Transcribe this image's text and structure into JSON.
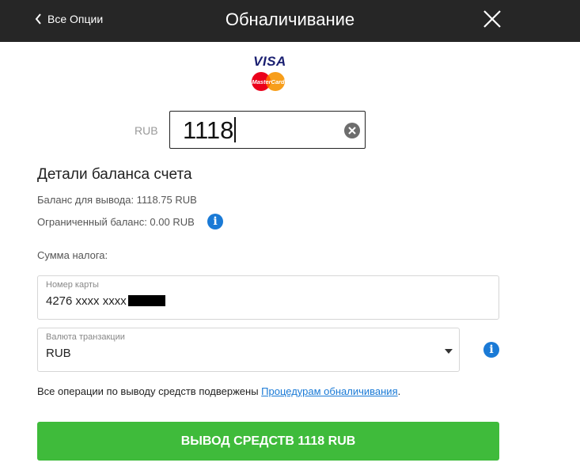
{
  "header": {
    "back_label": "Все Опции",
    "title": "Обналичивание"
  },
  "payment_logo": {
    "visa_text": "VISA",
    "mastercard_text": "MasterCard"
  },
  "amount": {
    "currency": "RUB",
    "value": "1118"
  },
  "balance": {
    "section_title": "Детали баланса счета",
    "withdrawable": "Баланс для вывода: 1118.75 RUB",
    "restricted": "Ограниченный баланс: 0.00 RUB",
    "tax_label": "Сумма налога:"
  },
  "card_field": {
    "label": "Номер карты",
    "value": "4276 xxxx xxxx"
  },
  "currency_field": {
    "label": "Валюта транзакции",
    "value": "RUB"
  },
  "notice": {
    "text": "Все операции по выводу средств подвержены ",
    "link": "Процедурам обналичивания",
    "suffix": "."
  },
  "submit": {
    "label": "ВЫВОД СРЕДСТВ 1118 RUB"
  },
  "colors": {
    "header_bg": "#262626",
    "accent_green": "#3fbb3b",
    "info_blue": "#1a7ad6"
  }
}
